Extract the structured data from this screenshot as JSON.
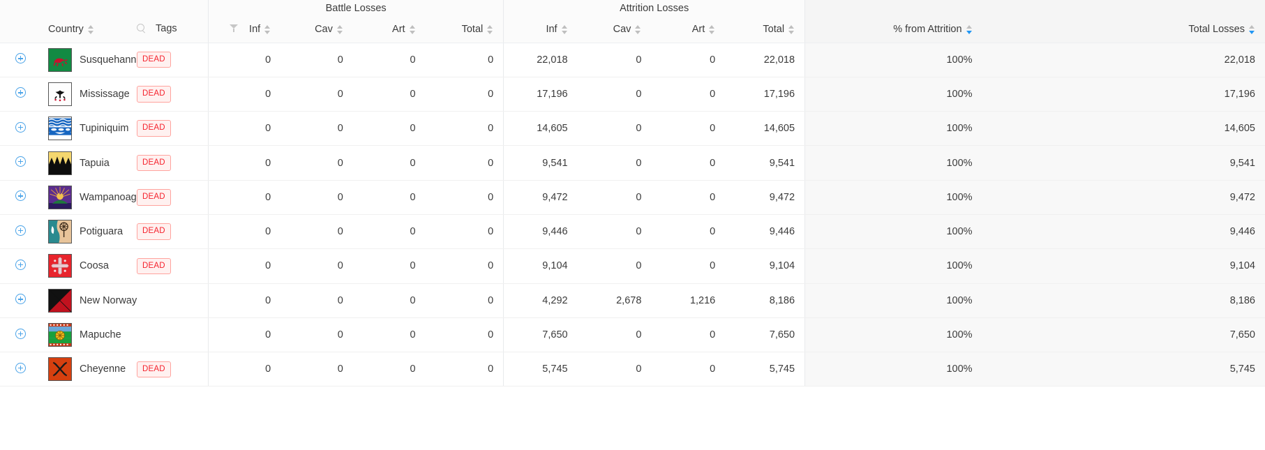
{
  "header": {
    "groups": [
      {
        "label": "",
        "span": 3
      },
      {
        "label": "Battle Losses",
        "span": 4
      },
      {
        "label": "Attrition Losses",
        "span": 4
      },
      {
        "label": "",
        "span": 1
      },
      {
        "label": "",
        "span": 1
      }
    ],
    "group_battle": "Battle Losses",
    "group_attrition": "Attrition Losses",
    "columns": {
      "country": "Country",
      "tags": "Tags",
      "battle_inf": "Inf",
      "battle_cav": "Cav",
      "battle_art": "Art",
      "battle_total": "Total",
      "attr_inf": "Inf",
      "attr_cav": "Cav",
      "attr_art": "Art",
      "attr_total": "Total",
      "pct_attrition": "% from Attrition",
      "total_losses": "Total Losses"
    },
    "icons": {
      "search": "search-icon",
      "filter": "filter-icon",
      "sort": "sort-icon",
      "expand": "expand-plus-icon"
    },
    "sort": {
      "active_column": "Total Losses",
      "direction": "desc",
      "accent_color": "#2196f3"
    }
  },
  "tag_colors": {
    "dead_text": "#f5222d",
    "dead_bg": "#fff1f0",
    "dead_border": "#ffa39e"
  },
  "rows": [
    {
      "country": "Susquehannock",
      "flag": "susquehannock",
      "tag": "DEAD",
      "battle": {
        "inf": "0",
        "cav": "0",
        "art": "0",
        "total": "0"
      },
      "attrition": {
        "inf": "22,018",
        "cav": "0",
        "art": "0",
        "total": "22,018"
      },
      "pct_attrition": "100%",
      "total_losses": "22,018"
    },
    {
      "country": "Mississage",
      "flag": "mississage",
      "tag": "DEAD",
      "battle": {
        "inf": "0",
        "cav": "0",
        "art": "0",
        "total": "0"
      },
      "attrition": {
        "inf": "17,196",
        "cav": "0",
        "art": "0",
        "total": "17,196"
      },
      "pct_attrition": "100%",
      "total_losses": "17,196"
    },
    {
      "country": "Tupiniquim",
      "flag": "tupiniquim",
      "tag": "DEAD",
      "battle": {
        "inf": "0",
        "cav": "0",
        "art": "0",
        "total": "0"
      },
      "attrition": {
        "inf": "14,605",
        "cav": "0",
        "art": "0",
        "total": "14,605"
      },
      "pct_attrition": "100%",
      "total_losses": "14,605"
    },
    {
      "country": "Tapuia",
      "flag": "tapuia",
      "tag": "DEAD",
      "battle": {
        "inf": "0",
        "cav": "0",
        "art": "0",
        "total": "0"
      },
      "attrition": {
        "inf": "9,541",
        "cav": "0",
        "art": "0",
        "total": "9,541"
      },
      "pct_attrition": "100%",
      "total_losses": "9,541"
    },
    {
      "country": "Wampanoag",
      "flag": "wampanoag",
      "tag": "DEAD",
      "battle": {
        "inf": "0",
        "cav": "0",
        "art": "0",
        "total": "0"
      },
      "attrition": {
        "inf": "9,472",
        "cav": "0",
        "art": "0",
        "total": "9,472"
      },
      "pct_attrition": "100%",
      "total_losses": "9,472"
    },
    {
      "country": "Potiguara",
      "flag": "potiguara",
      "tag": "DEAD",
      "battle": {
        "inf": "0",
        "cav": "0",
        "art": "0",
        "total": "0"
      },
      "attrition": {
        "inf": "9,446",
        "cav": "0",
        "art": "0",
        "total": "9,446"
      },
      "pct_attrition": "100%",
      "total_losses": "9,446"
    },
    {
      "country": "Coosa",
      "flag": "coosa",
      "tag": "DEAD",
      "battle": {
        "inf": "0",
        "cav": "0",
        "art": "0",
        "total": "0"
      },
      "attrition": {
        "inf": "9,104",
        "cav": "0",
        "art": "0",
        "total": "9,104"
      },
      "pct_attrition": "100%",
      "total_losses": "9,104"
    },
    {
      "country": "New Norway",
      "flag": "new-norway",
      "tag": "",
      "battle": {
        "inf": "0",
        "cav": "0",
        "art": "0",
        "total": "0"
      },
      "attrition": {
        "inf": "4,292",
        "cav": "2,678",
        "art": "1,216",
        "total": "8,186"
      },
      "pct_attrition": "100%",
      "total_losses": "8,186"
    },
    {
      "country": "Mapuche",
      "flag": "mapuche",
      "tag": "",
      "battle": {
        "inf": "0",
        "cav": "0",
        "art": "0",
        "total": "0"
      },
      "attrition": {
        "inf": "7,650",
        "cav": "0",
        "art": "0",
        "total": "7,650"
      },
      "pct_attrition": "100%",
      "total_losses": "7,650"
    },
    {
      "country": "Cheyenne",
      "flag": "cheyenne",
      "tag": "DEAD",
      "battle": {
        "inf": "0",
        "cav": "0",
        "art": "0",
        "total": "0"
      },
      "attrition": {
        "inf": "5,745",
        "cav": "0",
        "art": "0",
        "total": "5,745"
      },
      "pct_attrition": "100%",
      "total_losses": "5,745"
    }
  ]
}
